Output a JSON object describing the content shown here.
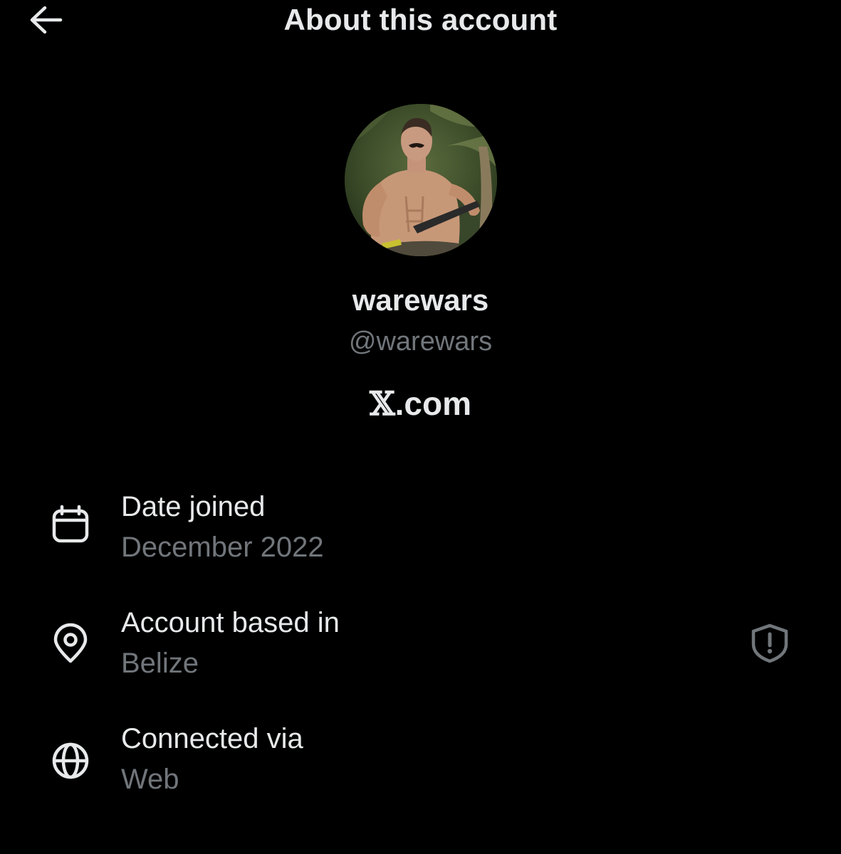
{
  "header": {
    "title": "About this account",
    "back_icon": "arrow-left-icon"
  },
  "profile": {
    "display_name": "warewars",
    "handle": "@warewars",
    "platform_mark": "𝕏",
    "platform_suffix": ".com"
  },
  "details": [
    {
      "icon": "calendar-icon",
      "label": "Date joined",
      "value": "December 2022"
    },
    {
      "icon": "location-pin-icon",
      "label": "Account based in",
      "value": "Belize",
      "trailing_icon": "shield-alert-icon"
    },
    {
      "icon": "globe-icon",
      "label": "Connected via",
      "value": "Web"
    }
  ],
  "colors": {
    "background": "#000000",
    "primary_text": "#e7e9ea",
    "secondary_text": "#71767b"
  }
}
